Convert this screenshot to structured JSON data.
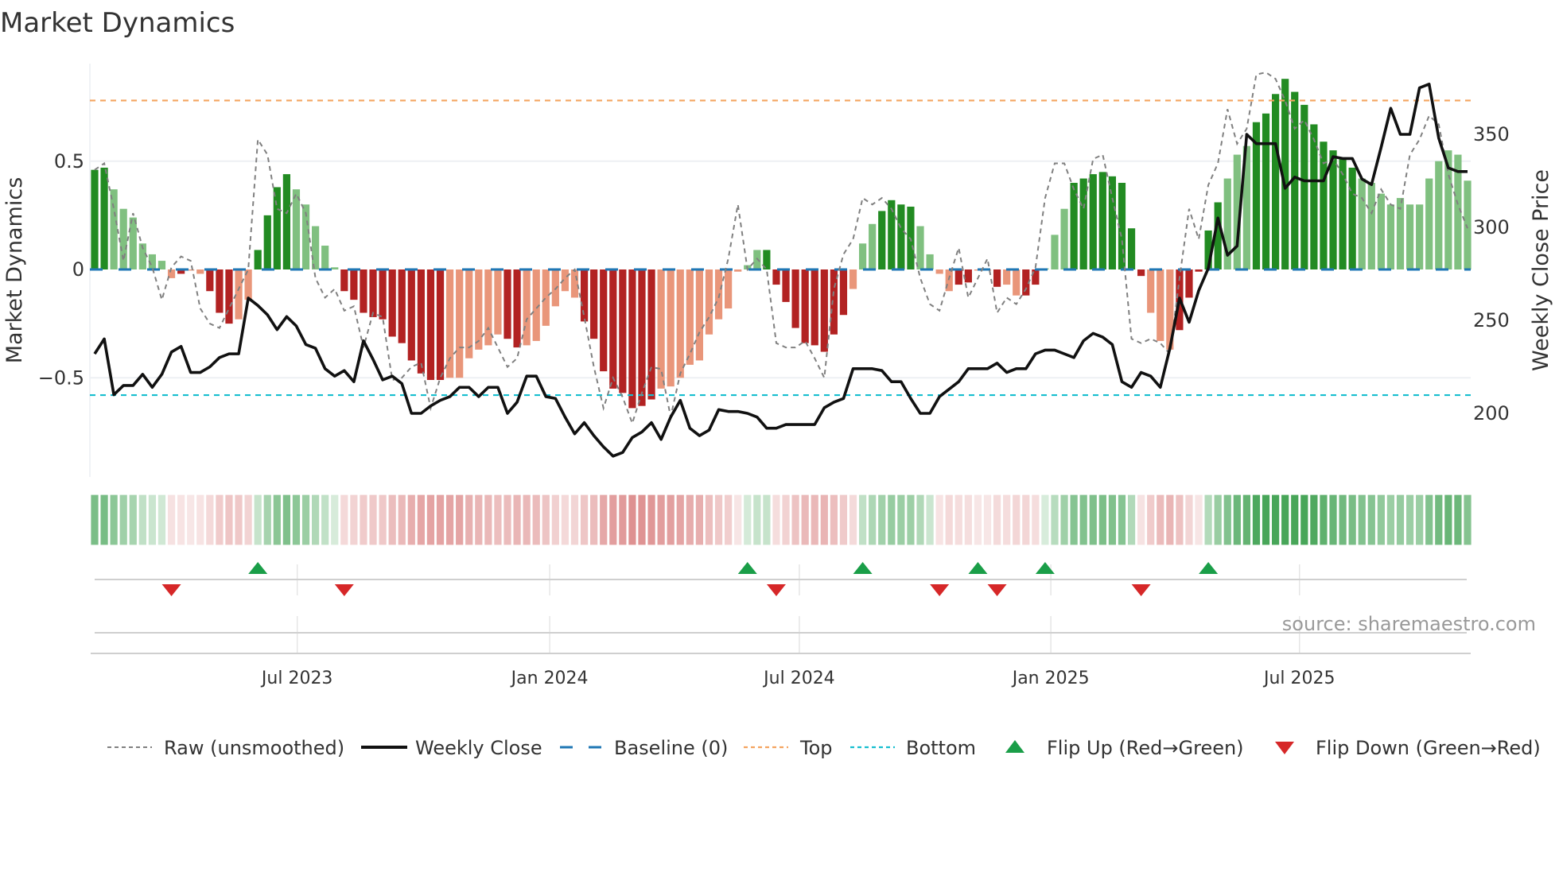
{
  "title": "Market Dynamics",
  "source": "source: sharemaestro.com",
  "chart_data": {
    "type": "bar",
    "title": "Market Dynamics",
    "ylabel": "Market Dynamics",
    "y2label": "Weekly Close Price",
    "yticks": [
      {
        "v": 0.5,
        "label": "0.5"
      },
      {
        "v": 0,
        "label": "0"
      },
      {
        "v": -0.5,
        "label": "−0.5"
      }
    ],
    "y2ticks": [
      {
        "v": 350,
        "label": "350"
      },
      {
        "v": 300,
        "label": "300"
      },
      {
        "v": 250,
        "label": "250"
      },
      {
        "v": 200,
        "label": "200"
      }
    ],
    "xticks": [
      {
        "index": 21.1,
        "label": "Jul 2023"
      },
      {
        "index": 47.4,
        "label": "Jan 2024"
      },
      {
        "index": 73.4,
        "label": "Jul 2024"
      },
      {
        "index": 99.6,
        "label": "Jan 2025"
      },
      {
        "index": 125.5,
        "label": "Jul 2025"
      }
    ],
    "levels": {
      "baseline": 0,
      "top": 0.78,
      "bottom": -0.58
    },
    "momentum": [
      0.46,
      0.47,
      0.37,
      0.28,
      0.24,
      0.12,
      0.07,
      0.04,
      -0.04,
      -0.02,
      -0.005,
      -0.02,
      -0.1,
      -0.2,
      -0.25,
      -0.23,
      -0.14,
      0.09,
      0.25,
      0.38,
      0.44,
      0.37,
      0.3,
      0.2,
      0.11,
      0.01,
      -0.1,
      -0.14,
      -0.2,
      -0.22,
      -0.23,
      -0.31,
      -0.34,
      -0.42,
      -0.48,
      -0.51,
      -0.51,
      -0.5,
      -0.5,
      -0.41,
      -0.37,
      -0.35,
      -0.3,
      -0.32,
      -0.36,
      -0.35,
      -0.33,
      -0.26,
      -0.17,
      -0.1,
      -0.13,
      -0.24,
      -0.32,
      -0.47,
      -0.55,
      -0.57,
      -0.64,
      -0.63,
      -0.6,
      -0.55,
      -0.54,
      -0.5,
      -0.44,
      -0.42,
      -0.3,
      -0.23,
      -0.18,
      -0.01,
      0.02,
      0.09,
      0.09,
      -0.07,
      -0.15,
      -0.27,
      -0.34,
      -0.35,
      -0.38,
      -0.3,
      -0.21,
      -0.09,
      0.12,
      0.21,
      0.27,
      0.32,
      0.3,
      0.29,
      0.2,
      0.07,
      -0.02,
      -0.1,
      -0.07,
      -0.06,
      -0.005,
      -0.005,
      -0.08,
      -0.07,
      -0.12,
      -0.12,
      -0.07,
      0.005,
      0.16,
      0.28,
      0.4,
      0.42,
      0.44,
      0.45,
      0.43,
      0.4,
      0.19,
      -0.03,
      -0.2,
      -0.33,
      -0.37,
      -0.28,
      -0.13,
      -0.01,
      0.18,
      0.31,
      0.42,
      0.53,
      0.57,
      0.68,
      0.72,
      0.81,
      0.88,
      0.82,
      0.76,
      0.67,
      0.59,
      0.55,
      0.51,
      0.47,
      0.42,
      0.4,
      0.35,
      0.3,
      0.33,
      0.3,
      0.3,
      0.42,
      0.5,
      0.55,
      0.53,
      0.41
    ],
    "shade": "ddllllllldlldddllddddllllldddddddddddllllllddllllllddddddddllllllllllldddddddddlllddddlllldd lldllddlllddddddddllldddddllldddddddddddlllllllllllldldddddll",
    "raw": [
      0.46,
      0.49,
      0.28,
      0.04,
      0.26,
      0.1,
      0.01,
      -0.14,
      0.01,
      0.06,
      0.04,
      -0.18,
      -0.25,
      -0.27,
      -0.18,
      -0.09,
      0,
      0.6,
      0.53,
      0.28,
      0.26,
      0.35,
      0.26,
      -0.04,
      -0.13,
      -0.09,
      -0.19,
      -0.17,
      -0.36,
      -0.2,
      -0.22,
      -0.51,
      -0.5,
      -0.45,
      -0.43,
      -0.64,
      -0.5,
      -0.41,
      -0.36,
      -0.36,
      -0.33,
      -0.27,
      -0.36,
      -0.45,
      -0.41,
      -0.23,
      -0.18,
      -0.13,
      -0.09,
      -0.04,
      0,
      -0.22,
      -0.45,
      -0.64,
      -0.5,
      -0.59,
      -0.71,
      -0.57,
      -0.45,
      -0.46,
      -0.68,
      -0.48,
      -0.39,
      -0.29,
      -0.22,
      -0.13,
      0.05,
      0.3,
      0,
      0.05,
      0,
      -0.34,
      -0.36,
      -0.36,
      -0.33,
      -0.41,
      -0.5,
      -0.09,
      0.07,
      0.14,
      0.33,
      0.3,
      0.33,
      0.28,
      0.19,
      0.14,
      -0.04,
      -0.16,
      -0.19,
      -0.04,
      0.1,
      -0.13,
      -0.04,
      0.05,
      -0.2,
      -0.13,
      -0.16,
      -0.09,
      0.01,
      0.33,
      0.49,
      0.49,
      0.37,
      0.28,
      0.51,
      0.53,
      0.33,
      0.14,
      -0.32,
      -0.34,
      -0.32,
      -0.34,
      -0.39,
      -0.04,
      0.28,
      0.14,
      0.39,
      0.49,
      0.74,
      0.58,
      0.65,
      0.9,
      0.91,
      0.88,
      0.78,
      0.65,
      0.69,
      0.6,
      0.49,
      0.51,
      0.44,
      0.35,
      0.33,
      0.26,
      0.37,
      0.3,
      0.28,
      0.53,
      0.6,
      0.71,
      0.67,
      0.44,
      0.3,
      0.19
    ],
    "close": [
      232,
      240,
      210,
      215,
      215,
      221,
      214,
      221,
      233,
      236,
      222,
      222,
      225,
      230,
      232,
      232,
      262,
      258,
      253,
      245,
      252,
      247,
      237,
      235,
      224,
      220,
      223,
      217,
      239,
      229,
      218,
      220,
      216,
      200,
      200,
      204,
      207,
      209,
      214,
      214,
      209,
      214,
      214,
      200,
      206,
      220,
      220,
      209,
      208,
      198,
      189,
      195,
      188,
      182,
      177,
      179,
      187,
      190,
      195,
      186,
      198,
      207,
      192,
      188,
      191,
      202,
      201,
      201,
      200,
      198,
      192,
      192,
      194,
      194,
      194,
      194,
      203,
      206,
      208,
      224,
      224,
      224,
      223,
      217,
      217,
      208,
      200,
      200,
      209,
      213,
      217,
      224,
      224,
      224,
      227,
      222,
      224,
      224,
      232,
      234,
      234,
      232,
      230,
      239,
      243,
      241,
      237,
      217,
      214,
      222,
      220,
      214,
      235,
      262,
      249,
      266,
      278,
      305,
      285,
      290,
      350,
      345,
      345,
      345,
      321,
      327,
      325,
      325,
      325,
      338,
      337,
      337,
      326,
      323,
      343,
      364,
      350,
      350,
      375,
      377,
      348,
      332,
      330,
      330
    ],
    "flips_up": [
      17,
      68,
      80,
      92,
      99,
      116
    ],
    "flips_down": [
      8,
      26,
      71,
      88,
      94,
      109
    ],
    "legend": [
      {
        "label": "Raw (unsmoothed)",
        "kind": "raw"
      },
      {
        "label": "Weekly Close",
        "kind": "close"
      },
      {
        "label": "Baseline (0)",
        "kind": "baseline"
      },
      {
        "label": "Top",
        "kind": "top"
      },
      {
        "label": "Bottom",
        "kind": "bottom"
      },
      {
        "label": "Flip Up (Red→Green)",
        "kind": "up"
      },
      {
        "label": "Flip Down (Green→Red)",
        "kind": "down"
      }
    ],
    "colors": {
      "dark_green": "#228b22",
      "light_green": "#80c080",
      "dark_red": "#b22222",
      "light_red": "#e9967a",
      "close": "#111111",
      "raw": "#808080",
      "baseline": "#1f77b4",
      "top": "#f4a460",
      "bottom": "#17becf",
      "flip_up": "#1a9e48",
      "flip_down": "#d62728"
    },
    "legend_position": "bottom"
  }
}
